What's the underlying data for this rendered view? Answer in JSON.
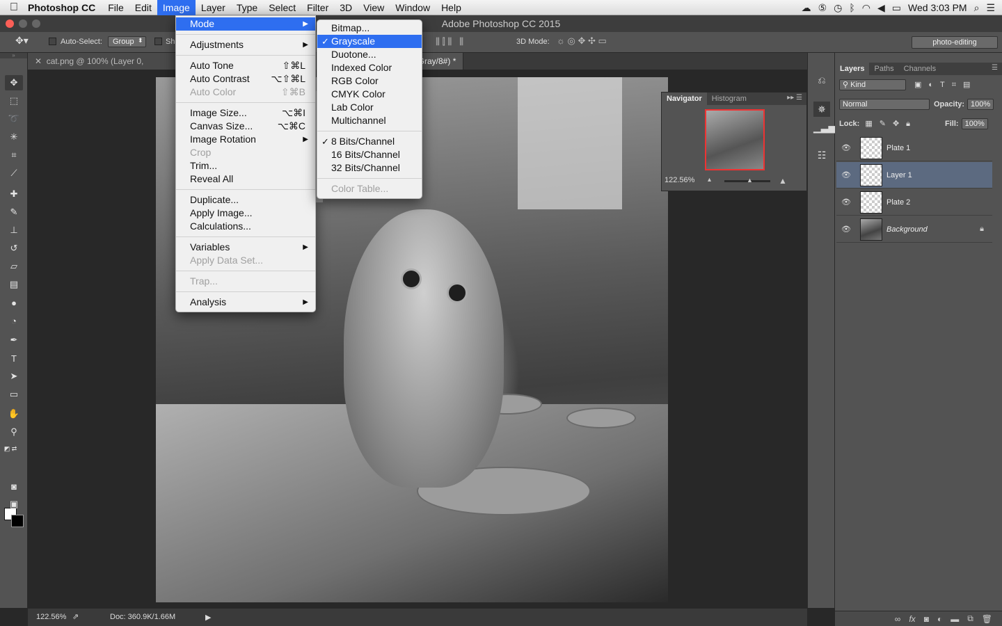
{
  "menubar": {
    "app_name": "Photoshop CC",
    "items": [
      "File",
      "Edit",
      "Image",
      "Layer",
      "Type",
      "Select",
      "Filter",
      "3D",
      "View",
      "Window",
      "Help"
    ],
    "active_item": "Image",
    "clock": "Wed 3:03 PM"
  },
  "window": {
    "title": "Adobe Photoshop CC 2015"
  },
  "options": {
    "auto_select_label": "Auto-Select:",
    "auto_select_value": "Group",
    "show_label": "Sh",
    "mode_3d_label": "3D Mode:",
    "workspace": "photo-editing"
  },
  "documents": {
    "tab1": "cat.png @ 100% (Layer 0, RGB/8#",
    "tab2": "r 1, Gray/8#) *"
  },
  "image_menu": {
    "mode": "Mode",
    "adjustments": "Adjustments",
    "auto_tone": "Auto Tone",
    "auto_tone_sc": "⇧⌘L",
    "auto_contrast": "Auto Contrast",
    "auto_contrast_sc": "⌥⇧⌘L",
    "auto_color": "Auto Color",
    "auto_color_sc": "⇧⌘B",
    "image_size": "Image Size...",
    "image_size_sc": "⌥⌘I",
    "canvas_size": "Canvas Size...",
    "canvas_size_sc": "⌥⌘C",
    "image_rotation": "Image Rotation",
    "crop": "Crop",
    "trim": "Trim...",
    "reveal_all": "Reveal All",
    "duplicate": "Duplicate...",
    "apply_image": "Apply Image...",
    "calculations": "Calculations...",
    "variables": "Variables",
    "apply_data_set": "Apply Data Set...",
    "trap": "Trap...",
    "analysis": "Analysis"
  },
  "mode_menu": {
    "bitmap": "Bitmap...",
    "grayscale": "Grayscale",
    "duotone": "Duotone...",
    "indexed": "Indexed Color",
    "rgb": "RGB Color",
    "cmyk": "CMYK Color",
    "lab": "Lab Color",
    "multichannel": "Multichannel",
    "bits8": "8 Bits/Channel",
    "bits16": "16 Bits/Channel",
    "bits32": "32 Bits/Channel",
    "color_table": "Color Table..."
  },
  "navigator": {
    "tab_navigator": "Navigator",
    "tab_histogram": "Histogram",
    "zoom": "122.56%"
  },
  "layers_panel": {
    "tabs": [
      "Layers",
      "Paths",
      "Channels"
    ],
    "filter": "Kind",
    "blend_mode": "Normal",
    "opacity_label": "Opacity:",
    "opacity": "100%",
    "lock_label": "Lock:",
    "fill_label": "Fill:",
    "fill": "100%",
    "layers": [
      "Plate 1",
      "Layer 1",
      "Plate 2",
      "Background"
    ],
    "selected_layer": "Layer 1"
  },
  "status": {
    "zoom": "122.56%",
    "doc": "Doc: 360.9K/1.66M"
  },
  "colors": {
    "menu_highlight": "#2e6ef0",
    "selected_layer": "#5c6a80"
  }
}
